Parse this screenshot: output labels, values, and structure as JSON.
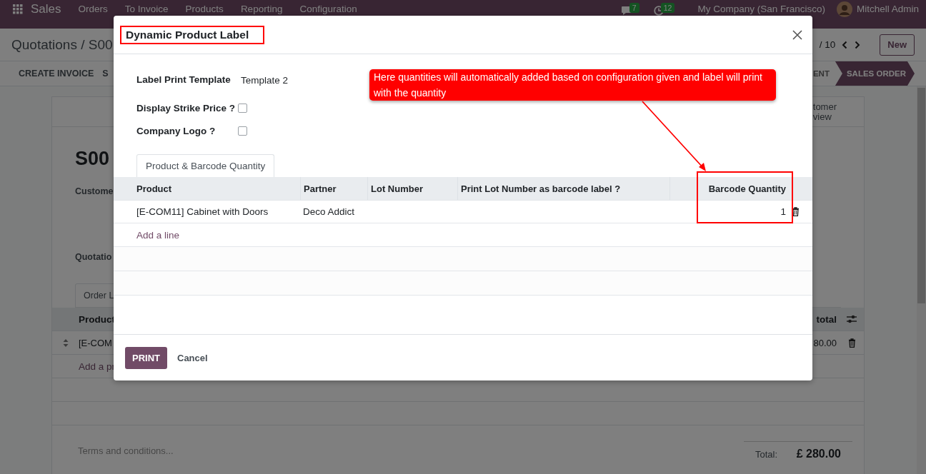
{
  "navbar": {
    "app": "Sales",
    "menu": [
      "Orders",
      "To Invoice",
      "Products",
      "Reporting",
      "Configuration"
    ],
    "messages_badge": "7",
    "activities_badge": "12",
    "company": "My Company (San Francisco)",
    "user": "Mitchell Admin"
  },
  "control_panel": {
    "breadcrumb": "Quotations / S00",
    "pager": "/ 10",
    "new_button": "New"
  },
  "status_bar": {
    "buttons": [
      "CREATE INVOICE",
      "S"
    ],
    "stages": [
      {
        "label": "ENT",
        "selected": false
      },
      {
        "label": "SALES ORDER",
        "selected": true
      }
    ]
  },
  "form": {
    "smart_button": [
      "tomer",
      "view"
    ],
    "title": "S00",
    "fields": [
      "Custome",
      "Quotatio"
    ],
    "tabs": [
      {
        "label": "Order L",
        "selected": true
      }
    ],
    "table": {
      "columns": [
        "Product",
        "total"
      ],
      "rows": [
        {
          "product": "[E-COM",
          "subtotal": "80.00"
        }
      ],
      "add_line": "Add a pr"
    },
    "terms_placeholder": "Terms and conditions...",
    "total_label": "Total:",
    "total_value": "£ 280.00"
  },
  "dialog": {
    "title": "Dynamic Product Label",
    "fields": [
      {
        "kind": "text",
        "label": "Label Print Template",
        "value": "Template 2"
      },
      {
        "kind": "checkbox",
        "label": "Display Strike Price ?",
        "checked": false
      },
      {
        "kind": "checkbox",
        "label": "Company Logo ?",
        "checked": false
      }
    ],
    "tabs": [
      {
        "label": "Product & Barcode Quantity",
        "selected": true
      }
    ],
    "table": {
      "columns": [
        "Product",
        "Partner",
        "Lot Number",
        "Print Lot Number as barcode label ?",
        "Barcode Quantity"
      ],
      "rows": [
        {
          "product": "[E-COM11] Cabinet with Doors",
          "partner": "Deco Addict",
          "barcode_quantity": "1"
        }
      ],
      "add_line": "Add a line"
    },
    "buttons": [
      {
        "label": "PRINT",
        "kind": "primary"
      },
      {
        "label": "Cancel",
        "kind": "secondary"
      }
    ]
  },
  "annotation": {
    "text": "Here quantities will automatically added based on configuration given and label will print with the quantity"
  }
}
